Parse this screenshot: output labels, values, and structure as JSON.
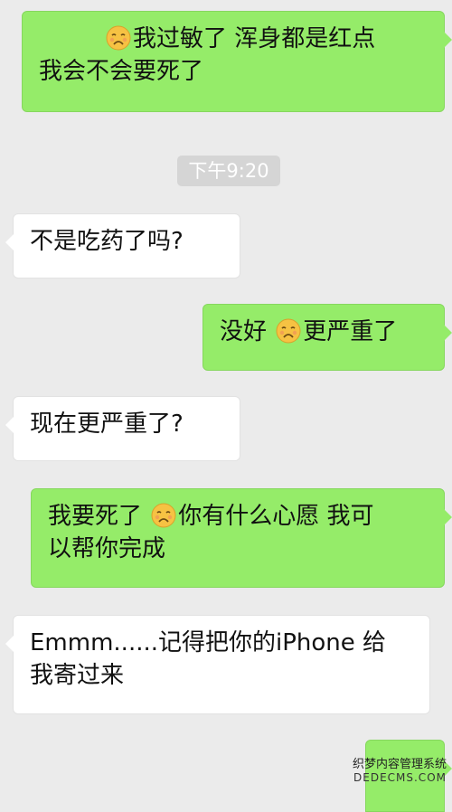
{
  "chat": {
    "timestamp": "下午9:20",
    "messages": [
      {
        "side": "sent",
        "pre": "",
        "emoji": "weary-face-emoji",
        "line1_after": "我过敏了 浑身都是红点",
        "line2": "我会不会要死了"
      },
      {
        "side": "recv",
        "line1": "不是吃药了吗?"
      },
      {
        "side": "sent",
        "pre": "没好",
        "emoji": "weary-face-emoji",
        "after": "更严重了"
      },
      {
        "side": "recv",
        "line1": "现在更严重了?"
      },
      {
        "side": "sent",
        "pre": "我要死了",
        "emoji": "weary-face-emoji",
        "line1_after": "你有什么心愿 我可",
        "line2": "以帮你完成"
      },
      {
        "side": "recv",
        "line1": "Emmm......记得把你的iPhone 给",
        "line2": "我寄过来"
      }
    ]
  },
  "watermark": {
    "line1": "织梦内容管理系统",
    "line2": "DEDECMS.COM"
  }
}
